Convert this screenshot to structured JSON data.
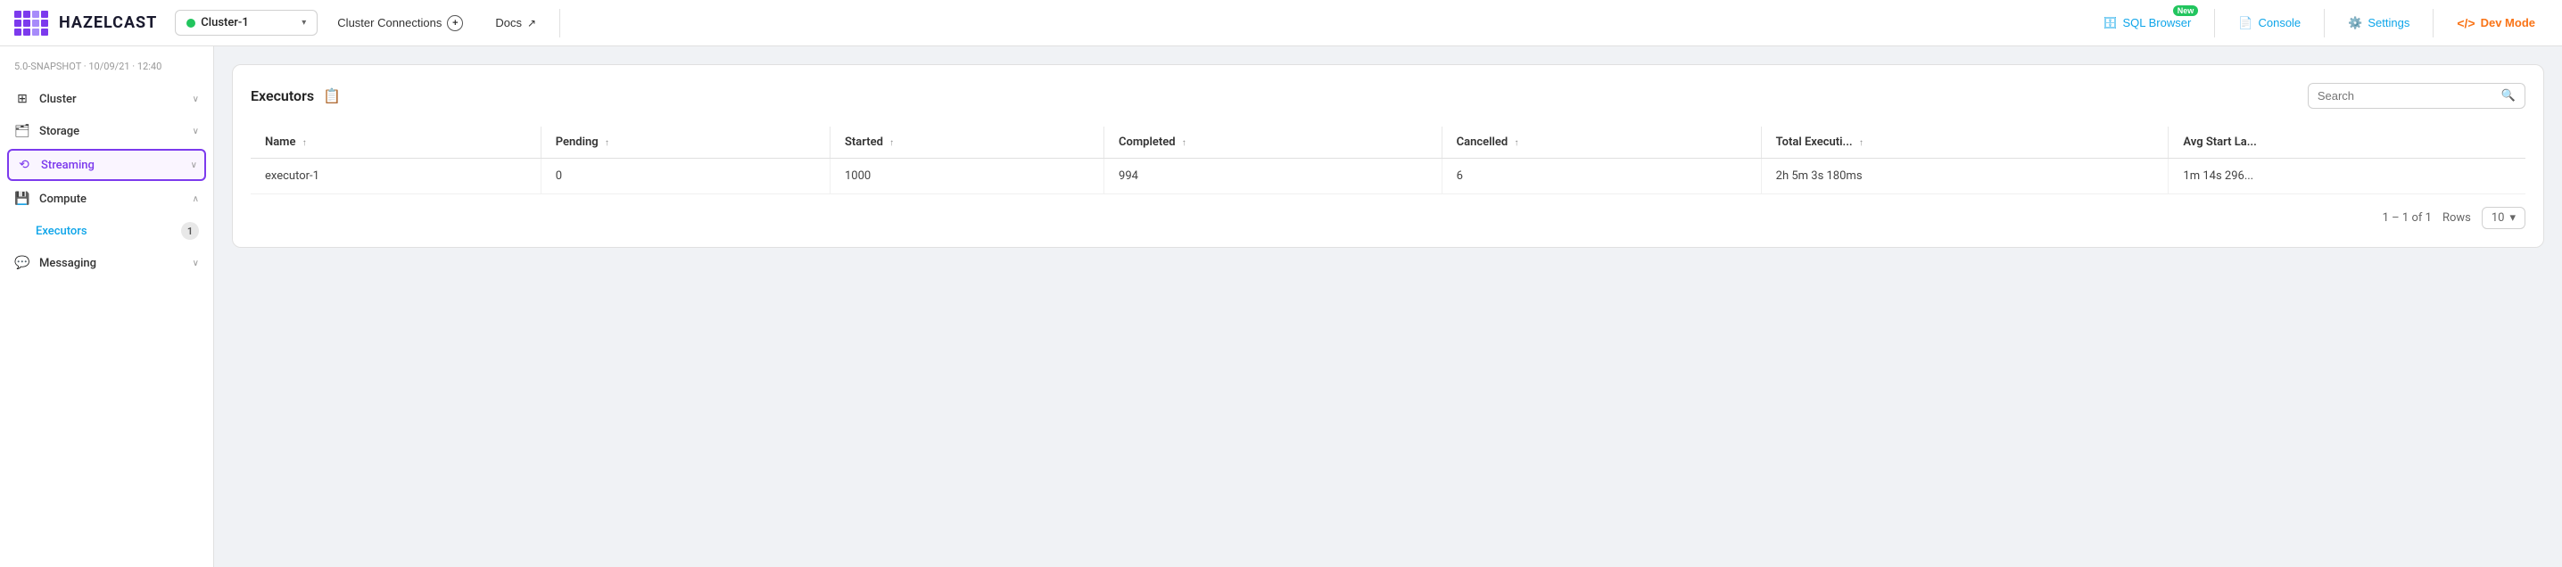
{
  "app": {
    "logo_text": "HAZELCAST"
  },
  "topnav": {
    "cluster_name": "Cluster-1",
    "cluster_connections_label": "Cluster Connections",
    "docs_label": "Docs",
    "sql_browser_label": "SQL Browser",
    "sql_browser_badge": "New",
    "console_label": "Console",
    "settings_label": "Settings",
    "dev_mode_label": "Dev Mode"
  },
  "sidebar": {
    "version": "5.0-SNAPSHOT · 10/09/21 · 12:40",
    "items": [
      {
        "id": "cluster",
        "label": "Cluster",
        "icon": "⊞",
        "chevron": "∨"
      },
      {
        "id": "storage",
        "label": "Storage",
        "icon": "🗂",
        "chevron": "∨"
      },
      {
        "id": "streaming",
        "label": "Streaming",
        "icon": "⟲",
        "chevron": "∨",
        "active": true
      },
      {
        "id": "compute",
        "label": "Compute",
        "icon": "💾",
        "chevron": "∧"
      },
      {
        "id": "messaging",
        "label": "Messaging",
        "icon": "💬",
        "chevron": "∨"
      }
    ],
    "sub_items": [
      {
        "id": "executors",
        "label": "Executors",
        "badge": "1"
      }
    ]
  },
  "panel": {
    "title": "Executors",
    "search_placeholder": "Search"
  },
  "table": {
    "columns": [
      {
        "id": "name",
        "label": "Name"
      },
      {
        "id": "pending",
        "label": "Pending"
      },
      {
        "id": "started",
        "label": "Started"
      },
      {
        "id": "completed",
        "label": "Completed"
      },
      {
        "id": "cancelled",
        "label": "Cancelled"
      },
      {
        "id": "total_executions",
        "label": "Total Executi..."
      },
      {
        "id": "avg_start_latency",
        "label": "Avg Start La..."
      }
    ],
    "rows": [
      {
        "name": "executor-1",
        "pending": "0",
        "started": "1000",
        "completed": "994",
        "cancelled": "6",
        "total_executions": "2h 5m 3s 180ms",
        "avg_start_latency": "1m 14s 296..."
      }
    ],
    "pagination": "1 – 1 of 1",
    "rows_label": "Rows",
    "rows_per_page": "10"
  }
}
